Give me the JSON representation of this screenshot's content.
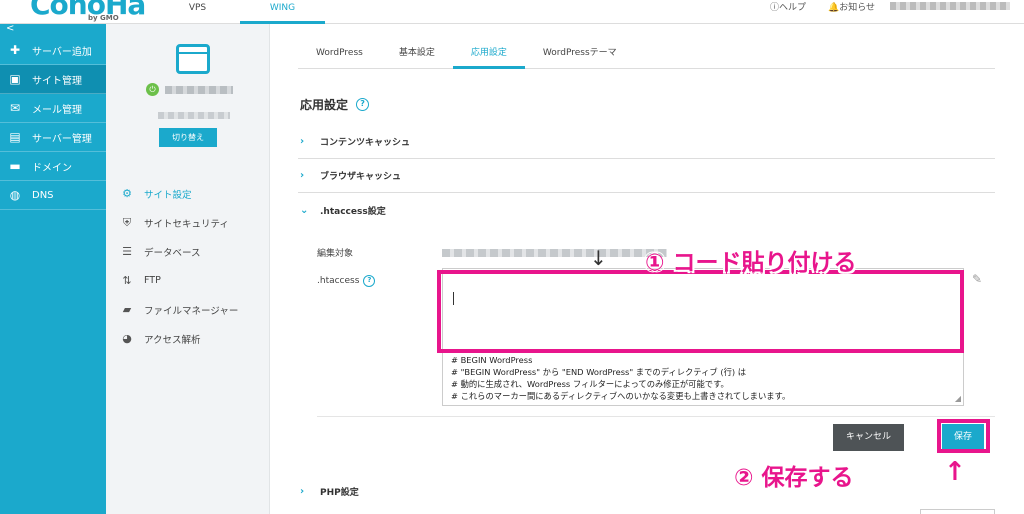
{
  "header": {
    "logo_text": "ConoHa",
    "logo_sub": "by GMO",
    "tabs": [
      {
        "label": "VPS"
      },
      {
        "label": "WING"
      }
    ],
    "util": {
      "help": "ヘルプ",
      "news": "お知らせ"
    }
  },
  "sidebar": {
    "collapse": "<",
    "items": [
      {
        "label": "サーバー追加",
        "icon": "plus-icon"
      },
      {
        "label": "サイト管理",
        "icon": "site-icon"
      },
      {
        "label": "メール管理",
        "icon": "mail-icon"
      },
      {
        "label": "サーバー管理",
        "icon": "server-icon"
      },
      {
        "label": "ドメイン",
        "icon": "domain-icon"
      },
      {
        "label": "DNS",
        "icon": "globe-icon"
      }
    ]
  },
  "subpanel": {
    "switch_label": "切り替え",
    "items": [
      {
        "label": "サイト設定",
        "icon": "site-settings-icon"
      },
      {
        "label": "サイトセキュリティ",
        "icon": "shield-icon"
      },
      {
        "label": "データベース",
        "icon": "database-icon"
      },
      {
        "label": "FTP",
        "icon": "ftp-icon"
      },
      {
        "label": "ファイルマネージャー",
        "icon": "folder-icon"
      },
      {
        "label": "アクセス解析",
        "icon": "pie-icon"
      }
    ]
  },
  "main": {
    "tabs": [
      {
        "label": "WordPress"
      },
      {
        "label": "基本設定"
      },
      {
        "label": "応用設定"
      },
      {
        "label": "WordPressテーマ"
      }
    ],
    "title": "応用設定",
    "sections": [
      {
        "label": "コンテンツキャッシュ"
      },
      {
        "label": "ブラウザキャッシュ"
      },
      {
        "label": ".htaccess設定"
      },
      {
        "label": "PHP設定"
      }
    ],
    "target_label": "編集対象",
    "htaccess_label": ".htaccess",
    "editor_lines": "# BEGIN WordPress\n# \"BEGIN WordPress\" から \"END WordPress\" までのディレクティブ (行) は\n# 動的に生成され、WordPress フィルターによってのみ修正が可能です。\n# これらのマーカー間にあるディレクティブへのいかなる変更も上書きされてしまいます。",
    "cancel_label": "キャンセル",
    "save_label": "保存"
  },
  "annotations": {
    "step1": "① コード貼り付ける",
    "step2": "② 保存する",
    "arrow_down": "↓",
    "arrow_up": "↑",
    "color": "#e8158c"
  },
  "colors": {
    "accent": "#1ba9cc",
    "active_sidebar": "#0f8fb1",
    "cancel_button": "#4e5356",
    "annotation": "#e8158c"
  }
}
